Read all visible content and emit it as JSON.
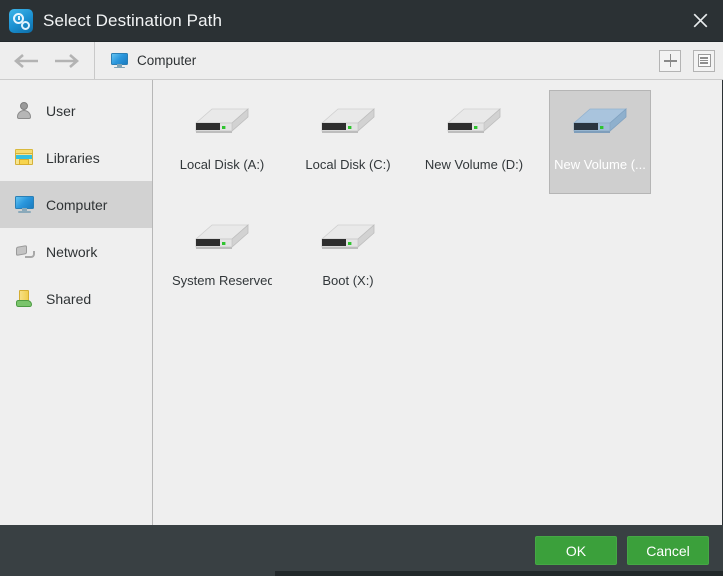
{
  "window": {
    "title": "Select Destination Path",
    "app_icon": "clock-gear-icon",
    "close_icon": "close-icon"
  },
  "navbar": {
    "back_icon": "arrow-left-icon",
    "forward_icon": "arrow-right-icon",
    "breadcrumb": {
      "icon": "computer-monitor-icon",
      "label": "Computer"
    },
    "tools": [
      {
        "name": "new-folder-button",
        "icon": "plus-icon"
      },
      {
        "name": "list-view-button",
        "icon": "list-view-icon"
      }
    ]
  },
  "sidebar": {
    "items": [
      {
        "label": "User",
        "icon": "user-icon",
        "selected": false
      },
      {
        "label": "Libraries",
        "icon": "libraries-icon",
        "selected": false
      },
      {
        "label": "Computer",
        "icon": "computer-icon",
        "selected": true
      },
      {
        "label": "Network",
        "icon": "network-icon",
        "selected": false
      },
      {
        "label": "Shared",
        "icon": "shared-icon",
        "selected": false
      }
    ]
  },
  "filepane": {
    "drives": [
      {
        "label": "Local Disk (A:)",
        "icon": "hard-drive-icon",
        "selected": false
      },
      {
        "label": "Local Disk (C:)",
        "icon": "hard-drive-icon",
        "selected": false
      },
      {
        "label": "New Volume (D:)",
        "icon": "hard-drive-icon",
        "selected": false
      },
      {
        "label": "New Volume (...",
        "icon": "hard-drive-icon",
        "selected": true
      },
      {
        "label": "System Reserved (G:)",
        "icon": "hard-drive-icon",
        "selected": false
      },
      {
        "label": "Boot (X:)",
        "icon": "hard-drive-icon",
        "selected": false
      }
    ]
  },
  "footer": {
    "ok_label": "OK",
    "cancel_label": "Cancel"
  },
  "colors": {
    "titlebar": "#2b3134",
    "footer": "#394043",
    "accent_green": "#3ba03b",
    "panel": "#efefef",
    "selection": "#d2d2d2",
    "icon_blue": "#2a97dd"
  }
}
